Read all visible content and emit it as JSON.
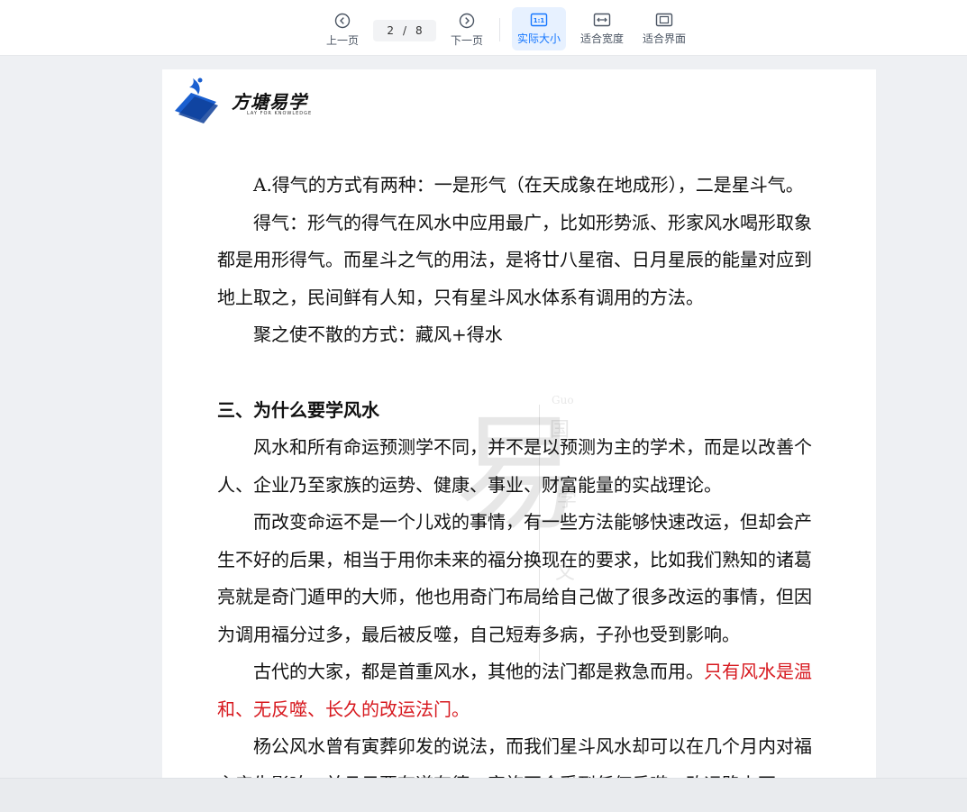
{
  "toolbar": {
    "prev_label": "上一页",
    "next_label": "下一页",
    "current_page": "2",
    "separator": "/",
    "total_pages": "8",
    "actual_size_label": "实际大小",
    "fit_width_label": "适合宽度",
    "fit_screen_label": "适合界面",
    "actual_size_icon_text": "1:1"
  },
  "logo": {
    "title": "方塘易学",
    "subtitle": "LAY FOR KNOWLEDGE"
  },
  "watermark": {
    "big": "易",
    "small_latin": "Guo",
    "c1": "国",
    "c2": "学",
    "c3": "文"
  },
  "document": {
    "p1": "A.得气的方式有两种：一是形气（在天成象在地成形），二是星斗气。",
    "p2": "得气：形气的得气在风水中应用最广，比如形势派、形家风水喝形取象都是用形得气。而星斗之气的用法，是将廿八星宿、日月星辰的能量对应到地上取之，民间鲜有人知，只有星斗风水体系有调用的方法。",
    "p3": "聚之使不散的方式：藏风+得水",
    "heading": "三、为什么要学风水",
    "p4": "风水和所有命运预测学不同，并不是以预测为主的学术，而是以改善个人、企业乃至家族的运势、健康、事业、财富能量的实战理论。",
    "p5": "而改变命运不是一个儿戏的事情，有一些方法能够快速改运，但却会产生不好的后果，相当于用你未来的福分换现在的要求，比如我们熟知的诸葛亮就是奇门遁甲的大师，他也用奇门布局给自己做了很多改运的事情，但因为调用福分过多，最后被反噬，自己短寿多病，子孙也受到影响。",
    "p6_black": "古代的大家，都是首重风水，其他的法门都是救急而用。",
    "p6_red": "只有风水是温和、无反噬、长久的改运法门。",
    "p7": "杨公风水曾有寅葬卯发的说法，而我们星斗风水却可以在几个月内对福主产生影响，并且只要有道有德，家族不会受到任何反噬，改运路上不"
  },
  "colors": {
    "accent": "#1677ff",
    "red_text": "#d7191f",
    "logo_blue": "#1a5fd0"
  }
}
